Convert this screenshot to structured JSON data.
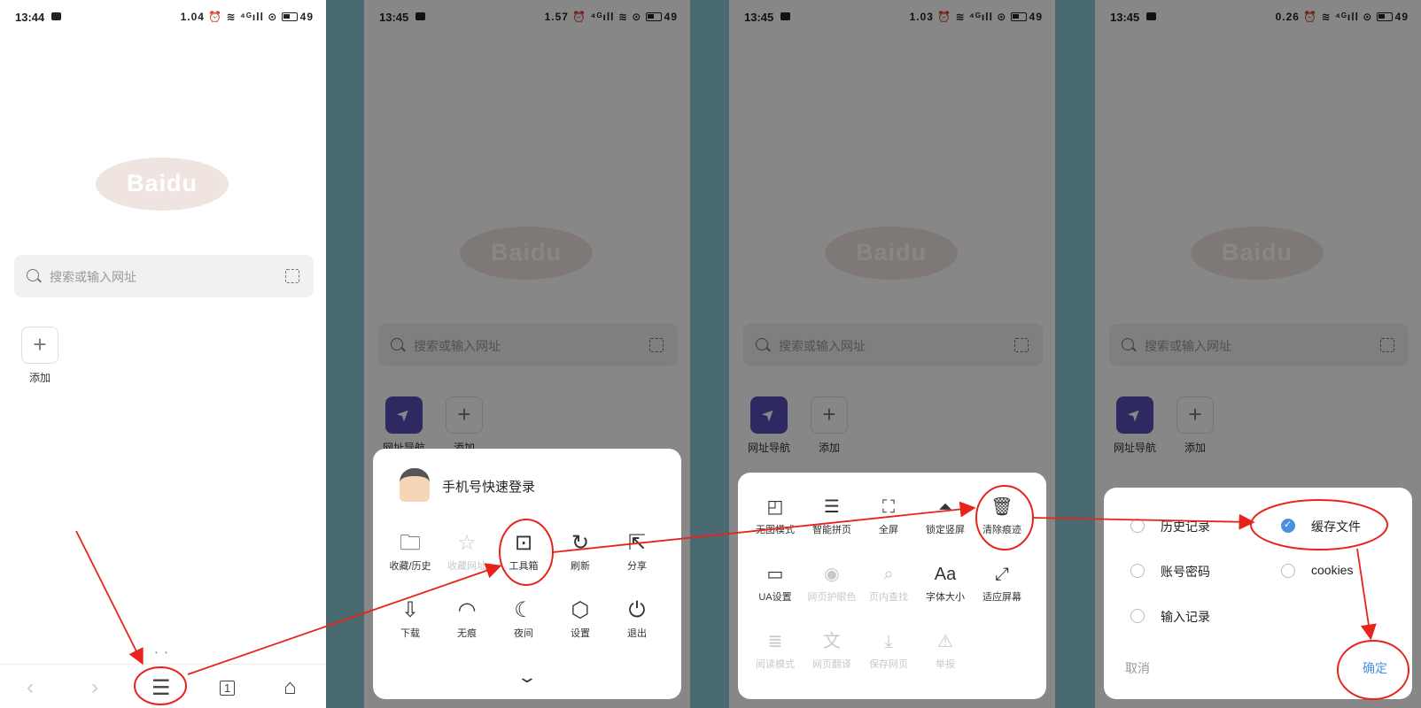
{
  "screens": [
    {
      "time": "13:44",
      "status_icons": "1.04 ⏰ ≋ ⁴ᴳıll ⊙",
      "battery": "49"
    },
    {
      "time": "13:45",
      "status_icons": "1.57 ⏰ ⁴ᴳıll ≋ ⊙",
      "battery": "49"
    },
    {
      "time": "13:45",
      "status_icons": "1.03 ⏰ ≋ ⁴ᴳıll ⊙",
      "battery": "49"
    },
    {
      "time": "13:45",
      "status_icons": "0.26 ⏰ ≋ ⁴ᴳıll ⊙",
      "battery": "49"
    }
  ],
  "home": {
    "logo_text": "Baidu",
    "search_placeholder": "搜索或输入网址",
    "add_label": "添加",
    "nav_label": "网址导航"
  },
  "bottom_nav": {
    "back": "‹",
    "forward": "›",
    "menu": "☰",
    "tabs": "1",
    "home": "⌂"
  },
  "menu_sheet": {
    "login_text": "手机号快速登录",
    "items": [
      {
        "icon": "folder-icon",
        "glyph": "🗀",
        "label": "收藏/历史"
      },
      {
        "icon": "star-icon",
        "glyph": "☆",
        "label": "收藏网址"
      },
      {
        "icon": "toolbox-icon",
        "glyph": "⊡",
        "label": "工具箱"
      },
      {
        "icon": "refresh-icon",
        "glyph": "↻",
        "label": "刷新"
      },
      {
        "icon": "share-icon",
        "glyph": "⇱",
        "label": "分享"
      },
      {
        "icon": "download-icon",
        "glyph": "⇩",
        "label": "下载"
      },
      {
        "icon": "ghost-icon",
        "glyph": "◠",
        "label": "无痕"
      },
      {
        "icon": "moon-icon",
        "glyph": "☾",
        "label": "夜间"
      },
      {
        "icon": "settings-icon",
        "glyph": "⬡",
        "label": "设置"
      },
      {
        "icon": "power-icon",
        "glyph": "⏻",
        "label": "退出"
      }
    ],
    "collapse_glyph": "⌄"
  },
  "toolbox_sheet": {
    "items": [
      {
        "icon": "no-image-icon",
        "glyph": "◰",
        "label": "无图模式"
      },
      {
        "icon": "smart-page-icon",
        "glyph": "☰",
        "label": "智能拼页"
      },
      {
        "icon": "fullscreen-icon",
        "glyph": "⛶",
        "label": "全屏"
      },
      {
        "icon": "lock-portrait-icon",
        "glyph": "⏶",
        "label": "锁定竖屏"
      },
      {
        "icon": "trash-icon",
        "glyph": "🗑",
        "label": "清除痕迹"
      },
      {
        "icon": "monitor-icon",
        "glyph": "▭",
        "label": "UA设置"
      },
      {
        "icon": "eye-icon",
        "glyph": "◉",
        "label": "网页护眼色"
      },
      {
        "icon": "find-in-page-icon",
        "glyph": "⌕",
        "label": "页内查找"
      },
      {
        "icon": "font-size-icon",
        "glyph": "Aa",
        "label": "字体大小"
      },
      {
        "icon": "fit-screen-icon",
        "glyph": "⤢",
        "label": "适应屏幕"
      },
      {
        "icon": "reader-icon",
        "glyph": "≣",
        "label": "阅读模式"
      },
      {
        "icon": "translate-icon",
        "glyph": "文",
        "label": "网页翻译"
      },
      {
        "icon": "save-page-icon",
        "glyph": "⤓",
        "label": "保存网页"
      },
      {
        "icon": "report-icon",
        "glyph": "⚠",
        "label": "举报"
      }
    ]
  },
  "clear_dialog": {
    "options_left": [
      "历史记录",
      "账号密码",
      "输入记录"
    ],
    "options_right": [
      "缓存文件",
      "cookies"
    ],
    "cancel": "取消",
    "confirm": "确定",
    "accent": "#4a90e2"
  }
}
